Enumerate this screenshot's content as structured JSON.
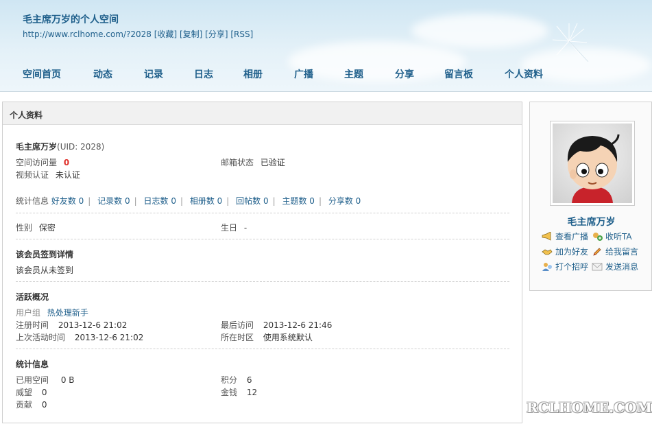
{
  "header": {
    "title": "毛主席万岁的个人空间",
    "url": "http://www.rclhome.com/?2028",
    "links": [
      "[收藏]",
      "[复制]",
      "[分享]",
      "[RSS]"
    ]
  },
  "nav": [
    "空间首页",
    "动态",
    "记录",
    "日志",
    "相册",
    "广播",
    "主题",
    "分享",
    "留言板",
    "个人资料"
  ],
  "panel": {
    "title": "个人资料",
    "username": "毛主席万岁",
    "uid": "(UID: 2028)",
    "visits_label": "空间访问量",
    "visits_value": "0",
    "email_label": "邮箱状态",
    "email_value": "已验证",
    "video_label": "视频认证",
    "video_value": "未认证",
    "stats_label": "统计信息",
    "stats": [
      "好友数 0",
      "记录数 0",
      "日志数 0",
      "相册数 0",
      "回帖数 0",
      "主题数 0",
      "分享数 0"
    ],
    "gender_label": "性别",
    "gender_value": "保密",
    "birthday_label": "生日",
    "birthday_value": "-",
    "signin_title": "该会员签到详情",
    "signin_text": "该会员从未签到",
    "activity_title": "活跃概况",
    "group_label": "用户组",
    "group_value": "热处理新手",
    "reg_label": "注册时间",
    "reg_value": "2013-12-6 21:02",
    "last_visit_label": "最后访问",
    "last_visit_value": "2013-12-6 21:46",
    "last_active_label": "上次活动时间",
    "last_active_value": "2013-12-6 21:02",
    "timezone_label": "所在时区",
    "timezone_value": "使用系统默认",
    "stat_title": "统计信息",
    "space_label": "已用空间",
    "space_value": "0 B",
    "points_label": "积分",
    "points_value": "6",
    "prestige_label": "威望",
    "prestige_value": "0",
    "money_label": "金钱",
    "money_value": "12",
    "contrib_label": "贡献",
    "contrib_value": "0"
  },
  "side": {
    "name": "毛主席万岁",
    "actions": {
      "broadcast": "查看广播",
      "listen": "收听TA",
      "add_friend": "加为好友",
      "message": "给我留言",
      "greet": "打个招呼",
      "send_msg": "发送消息"
    }
  },
  "watermark": "RCLHOME.COM"
}
